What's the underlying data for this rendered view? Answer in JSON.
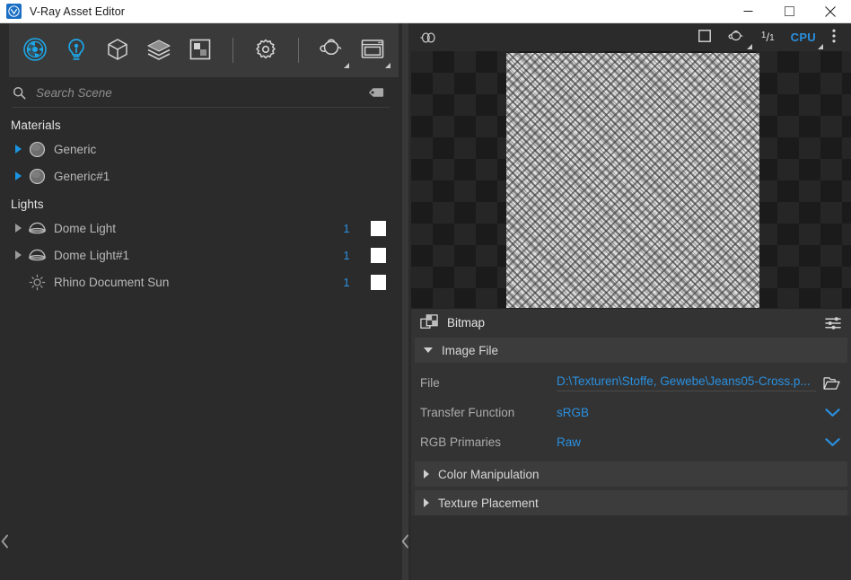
{
  "window": {
    "title": "V-Ray Asset Editor",
    "logo_icon": "vray-logo-icon",
    "minimize_label": "—",
    "maximize_label": "□",
    "close_label": "✕"
  },
  "toolbar": {
    "buttons": [
      {
        "name": "materials-button",
        "icon": "material-sphere-icon",
        "active": true
      },
      {
        "name": "lights-button",
        "icon": "light-bulb-icon",
        "active": true
      },
      {
        "name": "geometry-button",
        "icon": "cube-icon",
        "active": false
      },
      {
        "name": "render-elements-button",
        "icon": "layers-icon",
        "active": false
      },
      {
        "name": "textures-button",
        "icon": "texture-icon",
        "active": false
      },
      {
        "name": "settings-button",
        "icon": "gear-icon",
        "active": false
      },
      {
        "name": "render-button",
        "icon": "teapot-icon",
        "active": false
      },
      {
        "name": "render-frame-window-button",
        "icon": "render-window-icon",
        "active": false
      }
    ]
  },
  "search": {
    "placeholder": "Search Scene",
    "value": "",
    "icon": "search-icon",
    "filter_icon": "filter-tag-icon"
  },
  "tree": {
    "groups": [
      {
        "label": "Materials",
        "items": [
          {
            "name": "tree-item-generic",
            "label": "Generic",
            "icon": "material-sphere-icon",
            "arrow": "blue",
            "count": "",
            "swatch": false
          },
          {
            "name": "tree-item-generic-1",
            "label": "Generic#1",
            "icon": "material-sphere-icon",
            "arrow": "blue",
            "count": "",
            "swatch": false
          }
        ]
      },
      {
        "label": "Lights",
        "items": [
          {
            "name": "tree-item-dome-light",
            "label": "Dome Light",
            "icon": "dome-light-icon",
            "arrow": "grey",
            "count": "1",
            "swatch": true
          },
          {
            "name": "tree-item-dome-light-1",
            "label": "Dome Light#1",
            "icon": "dome-light-icon",
            "arrow": "grey",
            "count": "1",
            "swatch": true
          },
          {
            "name": "tree-item-rhino-document-sun",
            "label": "Rhino Document Sun",
            "icon": "sun-icon",
            "arrow": "none",
            "count": "1",
            "swatch": true
          }
        ]
      }
    ]
  },
  "preview_header": {
    "left_icon": "overlapping-circles-icon",
    "buttons": [
      {
        "name": "preview-flat-button",
        "icon": "square-icon",
        "label": ""
      },
      {
        "name": "preview-teapot-button",
        "icon": "teapot-icon",
        "label": ""
      }
    ],
    "ratio_numerator": "1",
    "ratio_slash": "/",
    "ratio_denominator": "1",
    "engine": "CPU",
    "menu_icon": "vertical-dots-icon"
  },
  "panel": {
    "title": "Bitmap",
    "title_icon": "bitmap-squares-icon",
    "sliders_icon": "sliders-icon",
    "sections": [
      {
        "name": "image-file-section",
        "label": "Image File",
        "expanded": true
      },
      {
        "name": "color-manipulation-section",
        "label": "Color Manipulation",
        "expanded": false
      },
      {
        "name": "texture-placement-section",
        "label": "Texture Placement",
        "expanded": false
      }
    ],
    "rows": [
      {
        "name": "file-row",
        "label": "File",
        "value": "D:\\Texturen\\Stoffe, Gewebe\\Jeans05-Cross.p...",
        "control": "folder",
        "control_icon": "open-folder-icon"
      },
      {
        "name": "transfer-function-row",
        "label": "Transfer Function",
        "value": "sRGB",
        "control": "dropdown",
        "control_icon": "chevron-down-icon"
      },
      {
        "name": "rgb-primaries-row",
        "label": "RGB Primaries",
        "value": "Raw",
        "control": "dropdown",
        "control_icon": "chevron-down-icon"
      }
    ]
  },
  "collapse": {
    "left_icon": "chevron-left-icon",
    "splitter_icon": "chevron-left-icon"
  },
  "colors": {
    "accent_blue": "#2a90e0",
    "toolbar_blue": "#1ea7e8",
    "titlebar_bg": "#ffffff",
    "panel_bg": "#333333",
    "window_bg": "#2b2b2b"
  }
}
